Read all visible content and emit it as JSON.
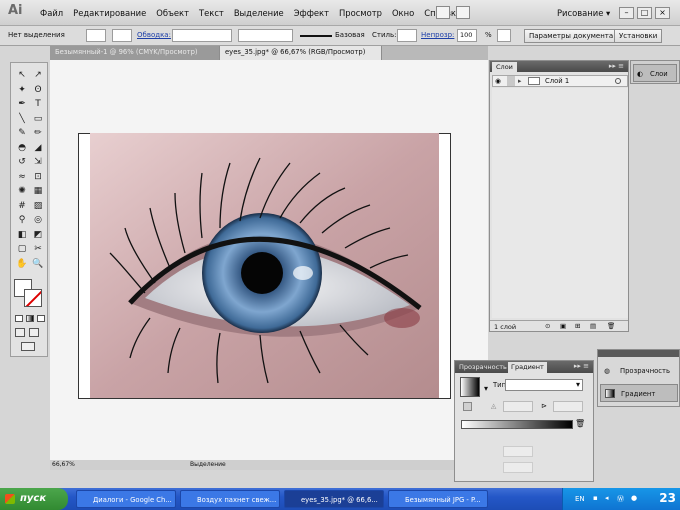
{
  "app": {
    "logo_text": "Ai",
    "menu": [
      "Файл",
      "Редактирование",
      "Объект",
      "Текст",
      "Выделение",
      "Эффект",
      "Просмотр",
      "Окно",
      "Справка"
    ],
    "workspace": "Рисование ▾"
  },
  "control_bar": {
    "selection_label": "Нет выделения",
    "stroke_label": "Обводка:",
    "basic_label": "Базовая",
    "style_label": "Стиль:",
    "opacity_label": "Непрозр:",
    "opacity_value": "100",
    "percent": "%",
    "doc_params_button": "Параметры документа",
    "settings_button": "Установки"
  },
  "tabs": [
    {
      "label": "Безымянный-1 @ 96% (CMYK/Просмотр)",
      "active": false
    },
    {
      "label": "eyes_35.jpg* @ 66,67% (RGB/Просмотр)",
      "active": true
    }
  ],
  "tools": [
    "selection-tool",
    "direct-selection-tool",
    "magic-wand-tool",
    "lasso-tool",
    "pen-tool",
    "type-tool",
    "line-tool",
    "rectangle-tool",
    "paintbrush-tool",
    "pencil-tool",
    "blob-brush-tool",
    "eraser-tool",
    "rotate-tool",
    "scale-tool",
    "warp-tool",
    "free-transform-tool",
    "symbol-sprayer-tool",
    "graph-tool",
    "mesh-tool",
    "gradient-tool",
    "eyedropper-tool",
    "blend-tool",
    "live-paint-tool",
    "live-paint-select-tool",
    "artboard-tool",
    "slice-tool",
    "hand-tool",
    "zoom-tool"
  ],
  "tool_glyphs": [
    "↖",
    "↗",
    "✦",
    "ʘ",
    "✒",
    "T",
    "╲",
    "▭",
    "✎",
    "✏",
    "◓",
    "◢",
    "↺",
    "⇲",
    "≈",
    "⊡",
    "✺",
    "▦",
    "#",
    "▨",
    "⚲",
    "◎",
    "◧",
    "◩",
    "▢",
    "✂",
    "✋",
    "🔍"
  ],
  "status_bar": {
    "zoom": "66,67%",
    "mode": "Выделение"
  },
  "layers_panel": {
    "tab": "Слои",
    "layer_name": "Слой 1",
    "footer_count": "1 слой"
  },
  "dock": {
    "top_item": "Слои",
    "transparency": "Прозрачность",
    "gradient": "Градиент"
  },
  "gradient_panel": {
    "tab_transparency": "Прозрачность",
    "tab_gradient": "Градиент",
    "type_label": "Тип:"
  },
  "taskbar": {
    "start": "пуск",
    "tasks": [
      {
        "label": "Диалоги - Google Ch...",
        "active": false
      },
      {
        "label": "Воздух пахнет свеж...",
        "active": false
      },
      {
        "label": "eyes_35.jpg* @ 66,6...",
        "active": true
      },
      {
        "label": "Безымянный JPG - P...",
        "active": false
      }
    ],
    "tray_lang": "EN",
    "clock": "23"
  }
}
